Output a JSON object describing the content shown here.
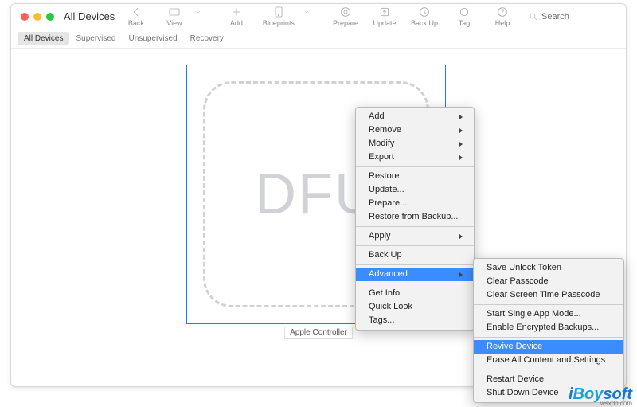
{
  "window": {
    "title": "All Devices"
  },
  "toolbar": {
    "back": "Back",
    "view": "View",
    "add": "Add",
    "blueprints": "Blueprints",
    "prepare": "Prepare",
    "update": "Update",
    "backup": "Back Up",
    "tag": "Tag",
    "help": "Help"
  },
  "search": {
    "placeholder": "Search"
  },
  "filters": {
    "all": "All Devices",
    "supervised": "Supervised",
    "unsupervised": "Unsupervised",
    "recovery": "Recovery"
  },
  "device": {
    "dfu": "DFU",
    "label": "Apple Controller"
  },
  "menu": {
    "add": "Add",
    "remove": "Remove",
    "modify": "Modify",
    "export": "Export",
    "restore": "Restore",
    "update": "Update...",
    "prepare": "Prepare...",
    "restore_backup": "Restore from Backup...",
    "apply": "Apply",
    "backup": "Back Up",
    "advanced": "Advanced",
    "getinfo": "Get Info",
    "quicklook": "Quick Look",
    "tags": "Tags..."
  },
  "submenu": {
    "save_token": "Save Unlock Token",
    "clear_passcode": "Clear Passcode",
    "clear_screen": "Clear Screen Time Passcode",
    "single_app": "Start Single App Mode...",
    "encrypted_backups": "Enable Encrypted Backups...",
    "revive": "Revive Device",
    "erase": "Erase All Content and Settings",
    "restart": "Restart Device",
    "shutdown": "Shut Down Device"
  },
  "watermark": {
    "brand_i": "i",
    "brand_b": "Boy",
    "brand_rest": "soft",
    "url": "wsxdn.com"
  }
}
